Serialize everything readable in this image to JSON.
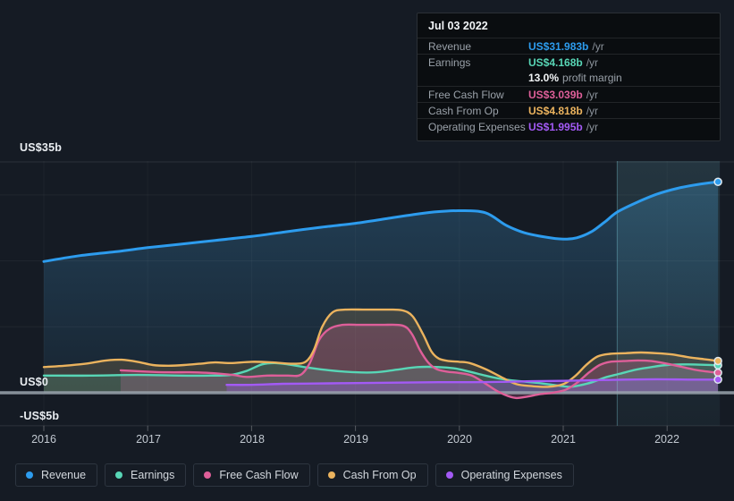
{
  "colors": {
    "revenue": "#2d9cee",
    "earnings": "#58d6b6",
    "fcf": "#de5f99",
    "cashop": "#ebb35e",
    "opex": "#a35af5",
    "zero_line": "#9aa5ae",
    "highlight": "#7ed6e9"
  },
  "tooltip": {
    "date": "Jul 03 2022",
    "rows": [
      {
        "label": "Revenue",
        "value": "US$31.983b",
        "suffix": "/yr",
        "series": "revenue"
      },
      {
        "label": "Earnings",
        "value": "US$4.168b",
        "suffix": "/yr",
        "series": "earnings"
      },
      {
        "label": "Free Cash Flow",
        "value": "US$3.039b",
        "suffix": "/yr",
        "series": "fcf"
      },
      {
        "label": "Cash From Op",
        "value": "US$4.818b",
        "suffix": "/yr",
        "series": "cashop"
      },
      {
        "label": "Operating Expenses",
        "value": "US$1.995b",
        "suffix": "/yr",
        "series": "opex"
      }
    ],
    "profit_margin": {
      "value": "13.0%",
      "label": "profit margin"
    }
  },
  "axis": {
    "y_labels": [
      "US$35b",
      "US$0",
      "-US$5b"
    ],
    "x_labels": [
      "2016",
      "2017",
      "2018",
      "2019",
      "2020",
      "2021",
      "2022"
    ]
  },
  "legend": [
    {
      "label": "Revenue",
      "series": "revenue"
    },
    {
      "label": "Earnings",
      "series": "earnings"
    },
    {
      "label": "Free Cash Flow",
      "series": "fcf"
    },
    {
      "label": "Cash From Op",
      "series": "cashop"
    },
    {
      "label": "Operating Expenses",
      "series": "opex"
    }
  ],
  "chart_data": {
    "type": "area",
    "y_unit": "US$ billions",
    "ylim": [
      -5,
      35
    ],
    "xlim": [
      2015.58,
      2022.64
    ],
    "y_gridlines_billions": [
      35,
      30,
      20,
      10,
      -5
    ],
    "x_ticks_years": [
      2016,
      2017,
      2018,
      2019,
      2020,
      2021,
      2022
    ],
    "highlight_period": {
      "from": 2021.52,
      "to": 2022.49
    },
    "legend_position": "bottom",
    "series": [
      {
        "name": "Revenue",
        "key": "revenue",
        "points": [
          [
            2016.0,
            19.9
          ],
          [
            2016.35,
            20.8
          ],
          [
            2016.7,
            21.4
          ],
          [
            2017.0,
            22.0
          ],
          [
            2017.3,
            22.5
          ],
          [
            2017.65,
            23.1
          ],
          [
            2018.0,
            23.7
          ],
          [
            2018.33,
            24.4
          ],
          [
            2018.67,
            25.1
          ],
          [
            2019.0,
            25.7
          ],
          [
            2019.3,
            26.4
          ],
          [
            2019.55,
            27.0
          ],
          [
            2019.75,
            27.4
          ],
          [
            2020.0,
            27.6
          ],
          [
            2020.25,
            27.3
          ],
          [
            2020.45,
            25.4
          ],
          [
            2020.62,
            24.3
          ],
          [
            2020.83,
            23.6
          ],
          [
            2021.0,
            23.3
          ],
          [
            2021.13,
            23.5
          ],
          [
            2021.27,
            24.4
          ],
          [
            2021.4,
            25.9
          ],
          [
            2021.52,
            27.4
          ],
          [
            2021.7,
            28.8
          ],
          [
            2021.9,
            30.1
          ],
          [
            2022.1,
            31.0
          ],
          [
            2022.3,
            31.6
          ],
          [
            2022.49,
            31.983
          ]
        ]
      },
      {
        "name": "Earnings",
        "key": "earnings",
        "points": [
          [
            2016.0,
            2.6
          ],
          [
            2016.45,
            2.6
          ],
          [
            2016.9,
            2.7
          ],
          [
            2017.3,
            2.6
          ],
          [
            2017.6,
            2.6
          ],
          [
            2017.8,
            2.7
          ],
          [
            2017.95,
            3.3
          ],
          [
            2018.1,
            4.3
          ],
          [
            2018.22,
            4.5
          ],
          [
            2018.35,
            4.3
          ],
          [
            2018.55,
            3.8
          ],
          [
            2018.75,
            3.4
          ],
          [
            2019.0,
            3.1
          ],
          [
            2019.2,
            3.1
          ],
          [
            2019.4,
            3.5
          ],
          [
            2019.6,
            3.9
          ],
          [
            2019.8,
            3.9
          ],
          [
            2019.95,
            3.7
          ],
          [
            2020.1,
            3.2
          ],
          [
            2020.25,
            2.6
          ],
          [
            2020.4,
            2.1
          ],
          [
            2020.55,
            1.8
          ],
          [
            2020.75,
            1.5
          ],
          [
            2020.9,
            1.2
          ],
          [
            2021.05,
            0.9
          ],
          [
            2021.15,
            1.1
          ],
          [
            2021.28,
            1.6
          ],
          [
            2021.4,
            2.3
          ],
          [
            2021.55,
            2.9
          ],
          [
            2021.7,
            3.5
          ],
          [
            2021.85,
            3.9
          ],
          [
            2022.0,
            4.2
          ],
          [
            2022.2,
            4.3
          ],
          [
            2022.49,
            4.168
          ]
        ]
      },
      {
        "name": "Free Cash Flow",
        "key": "fcf",
        "points": [
          [
            2016.74,
            3.4
          ],
          [
            2017.0,
            3.2
          ],
          [
            2017.2,
            3.1
          ],
          [
            2017.4,
            3.1
          ],
          [
            2017.6,
            3.0
          ],
          [
            2017.82,
            2.7
          ],
          [
            2017.95,
            2.4
          ],
          [
            2018.15,
            2.6
          ],
          [
            2018.35,
            2.6
          ],
          [
            2018.47,
            2.7
          ],
          [
            2018.56,
            4.5
          ],
          [
            2018.65,
            8.0
          ],
          [
            2018.75,
            9.7
          ],
          [
            2018.88,
            10.3
          ],
          [
            2019.05,
            10.3
          ],
          [
            2019.25,
            10.3
          ],
          [
            2019.45,
            10.2
          ],
          [
            2019.54,
            9.0
          ],
          [
            2019.62,
            6.5
          ],
          [
            2019.7,
            4.6
          ],
          [
            2019.78,
            3.6
          ],
          [
            2019.88,
            3.2
          ],
          [
            2020.0,
            3.0
          ],
          [
            2020.12,
            2.6
          ],
          [
            2020.25,
            1.4
          ],
          [
            2020.37,
            0.2
          ],
          [
            2020.47,
            -0.5
          ],
          [
            2020.55,
            -0.8
          ],
          [
            2020.65,
            -0.6
          ],
          [
            2020.78,
            -0.2
          ],
          [
            2020.9,
            0.0
          ],
          [
            2021.03,
            0.5
          ],
          [
            2021.14,
            1.6
          ],
          [
            2021.25,
            3.1
          ],
          [
            2021.35,
            4.2
          ],
          [
            2021.45,
            4.7
          ],
          [
            2021.58,
            4.8
          ],
          [
            2021.72,
            4.9
          ],
          [
            2021.85,
            4.8
          ],
          [
            2022.0,
            4.4
          ],
          [
            2022.15,
            3.9
          ],
          [
            2022.3,
            3.4
          ],
          [
            2022.49,
            3.039
          ]
        ]
      },
      {
        "name": "Cash From Op",
        "key": "cashop",
        "points": [
          [
            2016.0,
            3.9
          ],
          [
            2016.2,
            4.1
          ],
          [
            2016.4,
            4.4
          ],
          [
            2016.6,
            4.9
          ],
          [
            2016.75,
            5.0
          ],
          [
            2016.9,
            4.7
          ],
          [
            2017.05,
            4.2
          ],
          [
            2017.2,
            4.1
          ],
          [
            2017.35,
            4.2
          ],
          [
            2017.5,
            4.4
          ],
          [
            2017.65,
            4.6
          ],
          [
            2017.8,
            4.5
          ],
          [
            2018.0,
            4.7
          ],
          [
            2018.2,
            4.6
          ],
          [
            2018.4,
            4.4
          ],
          [
            2018.52,
            4.7
          ],
          [
            2018.6,
            6.5
          ],
          [
            2018.68,
            10.0
          ],
          [
            2018.78,
            12.2
          ],
          [
            2018.9,
            12.6
          ],
          [
            2019.1,
            12.6
          ],
          [
            2019.3,
            12.6
          ],
          [
            2019.45,
            12.5
          ],
          [
            2019.55,
            11.6
          ],
          [
            2019.65,
            8.9
          ],
          [
            2019.73,
            6.3
          ],
          [
            2019.8,
            5.2
          ],
          [
            2019.9,
            4.8
          ],
          [
            2020.0,
            4.7
          ],
          [
            2020.1,
            4.5
          ],
          [
            2020.25,
            3.6
          ],
          [
            2020.4,
            2.4
          ],
          [
            2020.55,
            1.3
          ],
          [
            2020.7,
            1.0
          ],
          [
            2020.85,
            0.9
          ],
          [
            2021.0,
            1.3
          ],
          [
            2021.12,
            2.6
          ],
          [
            2021.22,
            4.2
          ],
          [
            2021.33,
            5.5
          ],
          [
            2021.45,
            5.9
          ],
          [
            2021.6,
            6.0
          ],
          [
            2021.75,
            6.1
          ],
          [
            2021.9,
            6.0
          ],
          [
            2022.05,
            5.8
          ],
          [
            2022.2,
            5.4
          ],
          [
            2022.35,
            5.1
          ],
          [
            2022.49,
            4.818
          ]
        ]
      },
      {
        "name": "Operating Expenses",
        "key": "opex",
        "points": [
          [
            2017.76,
            1.2
          ],
          [
            2018.0,
            1.2
          ],
          [
            2018.3,
            1.35
          ],
          [
            2018.6,
            1.4
          ],
          [
            2018.9,
            1.45
          ],
          [
            2019.2,
            1.5
          ],
          [
            2019.5,
            1.55
          ],
          [
            2019.8,
            1.6
          ],
          [
            2020.1,
            1.6
          ],
          [
            2020.4,
            1.65
          ],
          [
            2020.7,
            1.75
          ],
          [
            2021.0,
            1.8
          ],
          [
            2021.3,
            1.9
          ],
          [
            2021.6,
            2.0
          ],
          [
            2021.9,
            2.05
          ],
          [
            2022.2,
            2.0
          ],
          [
            2022.49,
            1.995
          ]
        ]
      }
    ]
  }
}
